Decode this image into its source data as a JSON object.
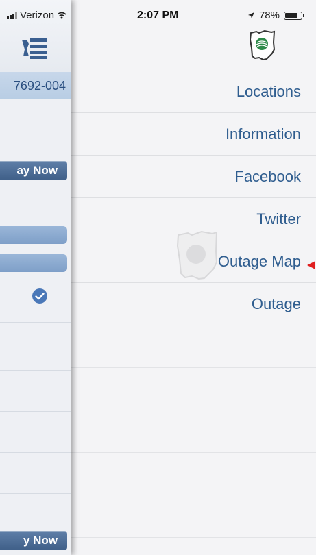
{
  "status_bar": {
    "carrier": "Verizon",
    "time": "2:07 PM",
    "battery": "78%"
  },
  "left_panel": {
    "account_number_fragment": "7692-004",
    "pay_button_top": "ay Now",
    "pay_button_bottom": "y Now"
  },
  "menu": {
    "items": [
      {
        "label": "Locations"
      },
      {
        "label": "Information"
      },
      {
        "label": "Facebook"
      },
      {
        "label": "Twitter"
      },
      {
        "label": "Outage Map"
      },
      {
        "label": "Outage"
      }
    ]
  },
  "icons": {
    "menu": "menu-list-icon",
    "logo": "ohio-logo-icon",
    "check": "check-circle-icon",
    "arrow": "red-pointer-arrow-icon"
  },
  "colors": {
    "menu_text": "#2f5d8f",
    "pay_button": "#4a6a94",
    "check": "#4a78b8",
    "annotation_arrow": "#e02020"
  }
}
